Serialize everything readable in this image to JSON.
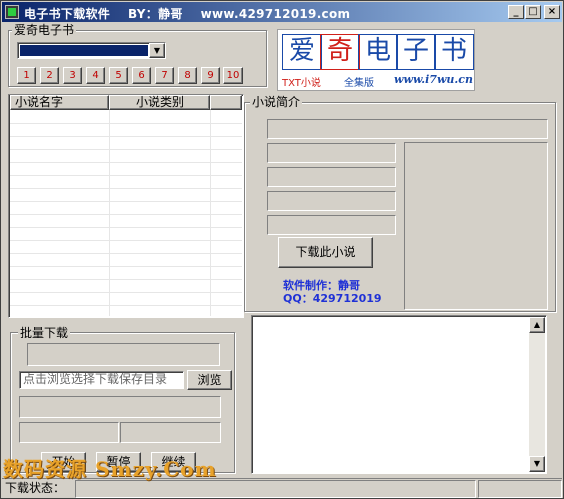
{
  "window": {
    "title": "电子书下载软件    BY：静哥    www.429712019.com",
    "min_glyph": "_",
    "max_glyph": "□",
    "close_glyph": "×"
  },
  "catalog_group": {
    "legend": "爱奇电子书",
    "dropdown_value": "",
    "page_buttons": [
      "1",
      "2",
      "3",
      "4",
      "5",
      "6",
      "7",
      "8",
      "9",
      "10"
    ]
  },
  "logo": {
    "chars": [
      "爱",
      "奇",
      "电",
      "子",
      "书"
    ],
    "sub_left": "TXT小说",
    "sub_right": "全集版",
    "site": "www.i7wu.cn"
  },
  "novel_list": {
    "col_name": "小说名字",
    "col_category": "小说类别",
    "rows": 15
  },
  "intro_group": {
    "legend": "小说简介",
    "download_button": "下载此小说",
    "credit_line1": "软件制作：静哥",
    "credit_line2": "QQ：429712019"
  },
  "batch_group": {
    "legend": "批量下载",
    "dir_placeholder": "点击浏览选择下载保存目录",
    "browse_button": "浏览",
    "start_button": "开始",
    "pause_button": "暂停",
    "resume_button": "继续"
  },
  "statusbar": {
    "label": "下载状态："
  },
  "watermark": "数码资源 Smzy.Com",
  "colors": {
    "title_start": "#0a246a",
    "title_end": "#a6caf0",
    "face": "#d4d0c8",
    "page_number": "#c00000",
    "credit": "#1f31d6"
  }
}
